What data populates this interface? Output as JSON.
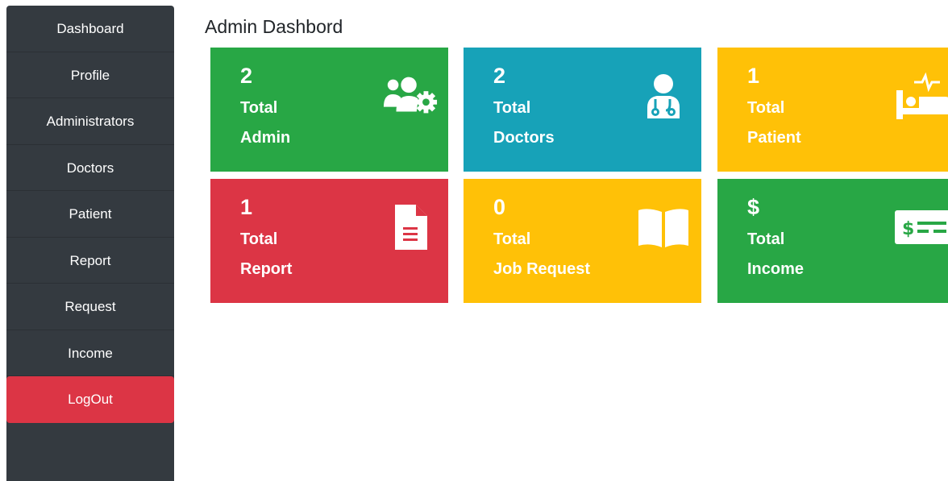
{
  "sidebar": {
    "items": [
      {
        "label": "Dashboard"
      },
      {
        "label": "Profile"
      },
      {
        "label": "Administrators"
      },
      {
        "label": "Doctors"
      },
      {
        "label": "Patient"
      },
      {
        "label": "Report"
      },
      {
        "label": "Request"
      },
      {
        "label": "Income"
      },
      {
        "label": "LogOut"
      }
    ]
  },
  "page": {
    "title": "Admin Dashbord"
  },
  "cards": [
    {
      "value": "2",
      "line1": "Total",
      "line2": "Admin",
      "icon": "users-cog-icon",
      "color": "#28a745"
    },
    {
      "value": "2",
      "line1": "Total",
      "line2": "Doctors",
      "icon": "doctor-icon",
      "color": "#17a2b8"
    },
    {
      "value": "1",
      "line1": "Total",
      "line2": "Patient",
      "icon": "hospital-bed-icon",
      "color": "#ffc107"
    },
    {
      "value": "1",
      "line1": "Total",
      "line2": "Report",
      "icon": "file-icon",
      "color": "#dc3545"
    },
    {
      "value": "0",
      "line1": "Total",
      "line2": "Job Request",
      "icon": "book-open-icon",
      "color": "#ffc107"
    },
    {
      "value": "$",
      "line1": "Total",
      "line2": "Income",
      "icon": "money-bill-icon",
      "color": "#28a745"
    }
  ]
}
